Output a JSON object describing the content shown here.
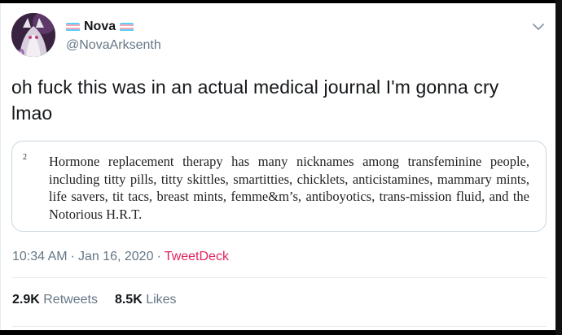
{
  "author": {
    "display_name": "Nova",
    "handle": "@NovaArksenth",
    "avatar_icon": "avatar-image",
    "flag_colors": [
      "#5bcefa",
      "#f5a9b8",
      "#ffffff",
      "#f5a9b8",
      "#5bcefa"
    ]
  },
  "tweet": {
    "text": "oh fuck this was in an actual medical journal I'm gonna cry lmao",
    "attachment": {
      "footnote_number": "2",
      "text": "Hormone replacement therapy has many nicknames among transfeminine people, including titty pills, titty skittles, smartitties, chicklets, anticistamines, mammary mints, life savers, tit tacs, breast mints, femme&m’s, antiboyotics, trans-mission fluid, and the Notorious H.R.T."
    },
    "time": "10:34 AM",
    "date": "Jan 16, 2020",
    "separator": "·",
    "source": "TweetDeck"
  },
  "stats": {
    "retweets_count": "2.9K",
    "retweets_label": "Retweets",
    "likes_count": "8.5K",
    "likes_label": "Likes"
  },
  "colors": {
    "source_link": "#e0245e",
    "secondary_text": "#657786",
    "primary_text": "#14171a"
  }
}
